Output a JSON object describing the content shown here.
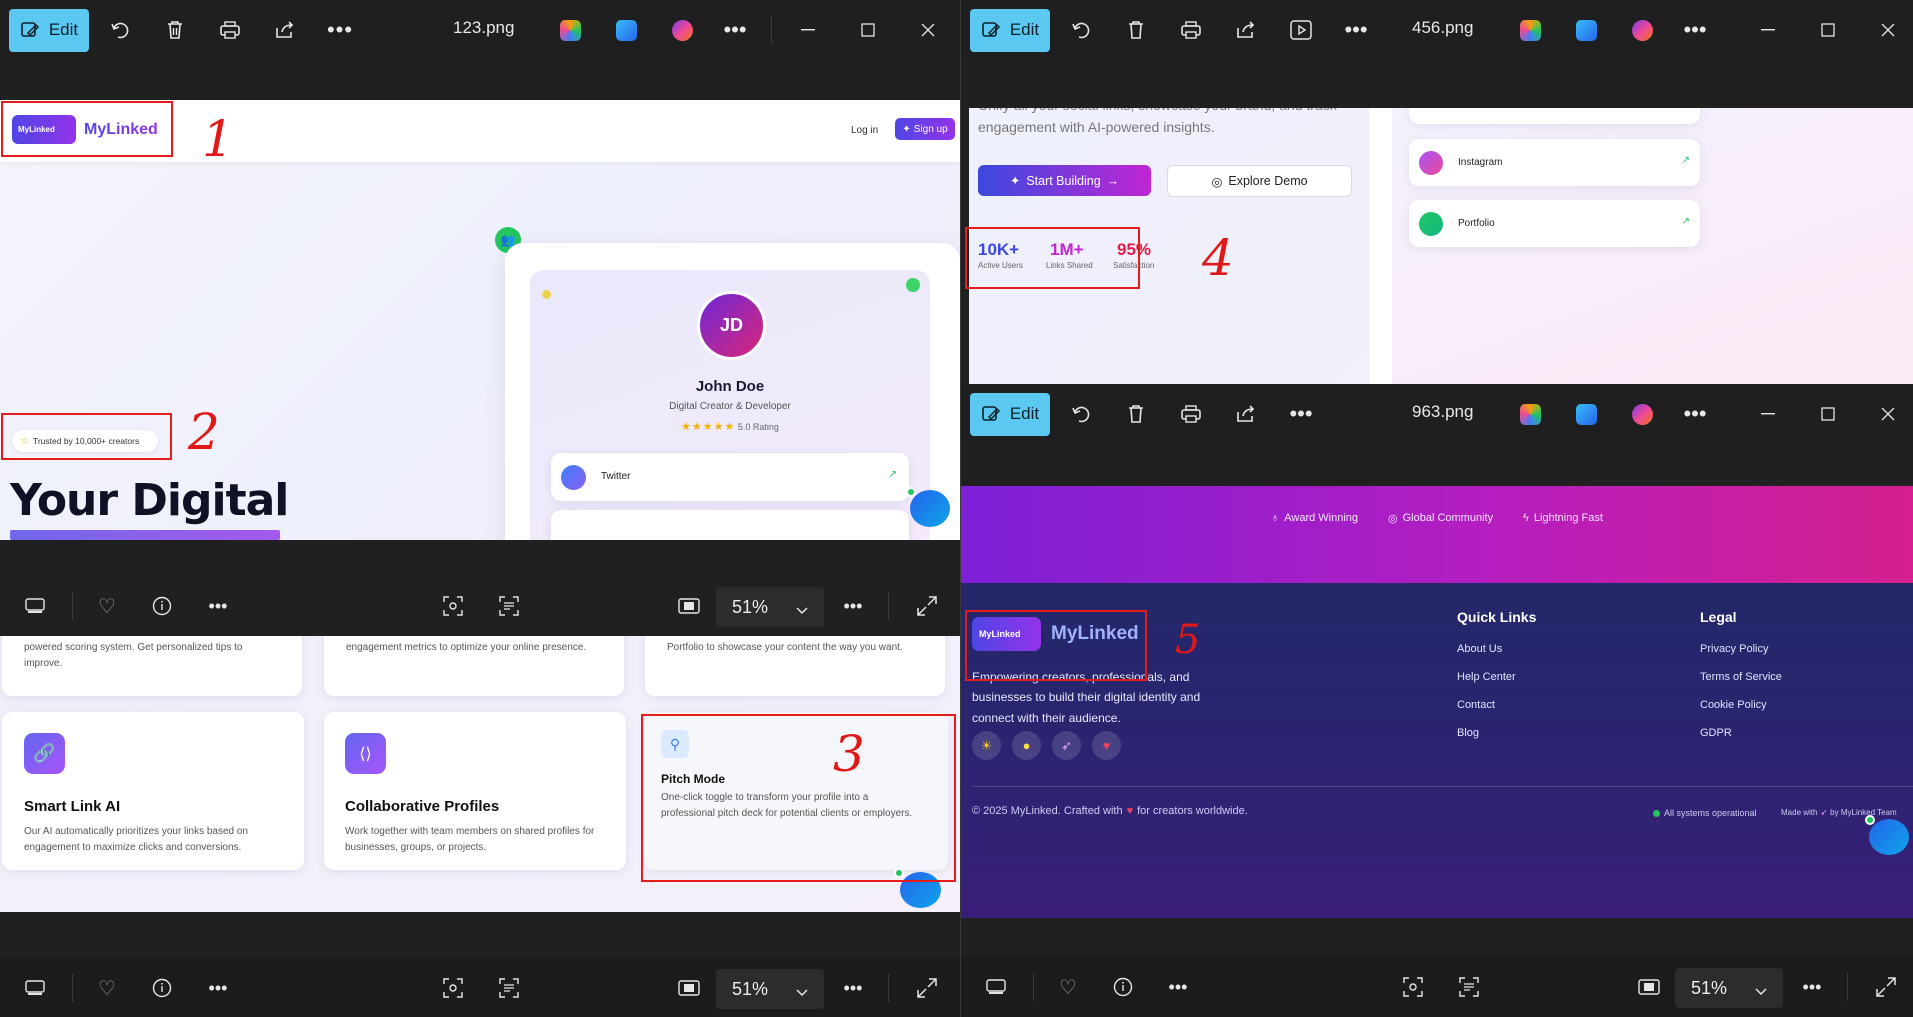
{
  "app": {
    "edit_label": "Edit",
    "zoom_value": "51%"
  },
  "windows": {
    "w1": {
      "filename": "123.png"
    },
    "w2": {
      "filename": "456.png"
    },
    "w3": {
      "filename": "963.png"
    }
  },
  "site": {
    "brand": "MyLinked",
    "logo_text": "MyLinked",
    "nav": {
      "login": "Log in",
      "signup": "Sign up"
    },
    "trusted_badge": "Trusted by 10,000+ creators",
    "hero_title": "Your Digital",
    "hero_tagline": "Unify all your social links, showcase your brand, and track engagement with AI-powered insights.",
    "profile": {
      "initials": "JD",
      "name": "John Doe",
      "role": "Digital Creator & Developer",
      "rating": "5.0 Rating",
      "links": [
        "Twitter",
        "Instagram",
        "Portfolio"
      ]
    },
    "cta": {
      "start": "Start Building",
      "demo": "Explore Demo"
    },
    "stats": [
      {
        "value": "10K+",
        "label": "Active Users",
        "color": "#3b49df"
      },
      {
        "value": "1M+",
        "label": "Links Shared",
        "color": "#c026d3"
      },
      {
        "value": "95%",
        "label": "Satisfaction",
        "color": "#e11d48"
      }
    ],
    "features_top": [
      "powered scoring system. Get personalized tips to improve.",
      "engagement metrics to optimize your online presence.",
      "Portfolio to showcase your content the way you want."
    ],
    "features": [
      {
        "title": "Smart Link AI",
        "desc": "Our AI automatically prioritizes your links based on engagement to maximize clicks and conversions."
      },
      {
        "title": "Collaborative Profiles",
        "desc": "Work together with team members on shared profiles for businesses, groups, or projects."
      },
      {
        "title": "Pitch Mode",
        "desc": "One-click toggle to transform your profile into a professional pitch deck for potential clients or employers."
      }
    ],
    "banner_items": [
      "Award Winning",
      "Global Community",
      "Lightning Fast"
    ],
    "footer": {
      "about": "Empowering creators, professionals, and businesses to build their digital identity and connect with their audience.",
      "quick_links_title": "Quick Links",
      "quick_links": [
        "About Us",
        "Help Center",
        "Contact",
        "Blog"
      ],
      "legal_title": "Legal",
      "legal": [
        "Privacy Policy",
        "Terms of Service",
        "Cookie Policy",
        "GDPR"
      ],
      "copyright_a": "© 2025 MyLinked. Crafted with",
      "copyright_b": "for creators worldwide.",
      "status": "All systems operational",
      "made_with_a": "Made with",
      "made_with_b": "by MyLinked Team"
    }
  },
  "annotations": [
    "1",
    "2",
    "3",
    "4",
    "5"
  ],
  "colors": {
    "accent": "#5ac8f0",
    "brand_purple": "#6d28d9",
    "annotation_red": "#e31c1c"
  }
}
